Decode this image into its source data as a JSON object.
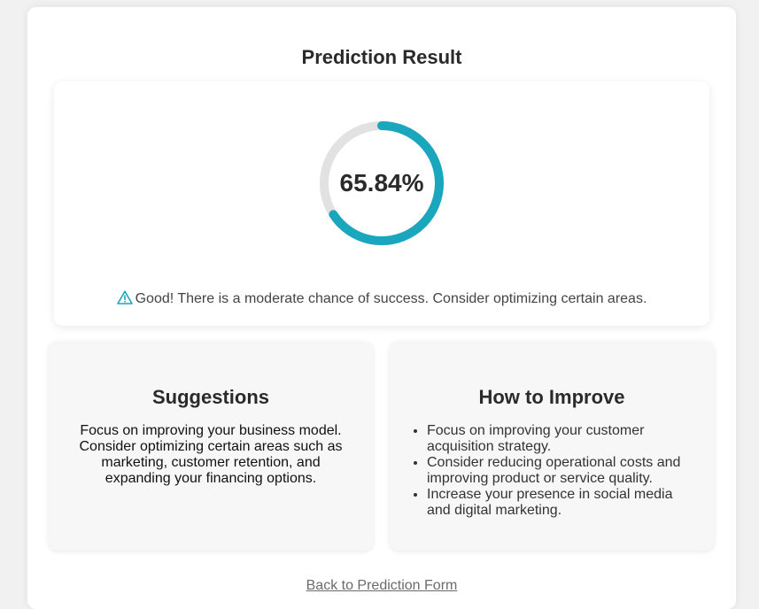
{
  "result": {
    "title": "Prediction Result",
    "percentage_text": "65.84%",
    "percentage_value": 65.84,
    "message": "Good! There is a moderate chance of success. Consider optimizing certain areas.",
    "message_icon": "warning-triangle-icon"
  },
  "colors": {
    "ring_fill": "#1aa7bd",
    "ring_track": "#e2e2e2",
    "warning_icon": "#1aa7bd"
  },
  "suggestions": {
    "heading": "Suggestions",
    "text": "Focus on improving your business model. Consider optimizing certain areas such as marketing, customer retention, and expanding your financing options."
  },
  "improve": {
    "heading": "How to Improve",
    "items": [
      "Focus on improving your customer acquisition strategy.",
      "Consider reducing operational costs and improving product or service quality.",
      "Increase your presence in social media and digital marketing."
    ]
  },
  "footer": {
    "back_link": "Back to Prediction Form"
  }
}
